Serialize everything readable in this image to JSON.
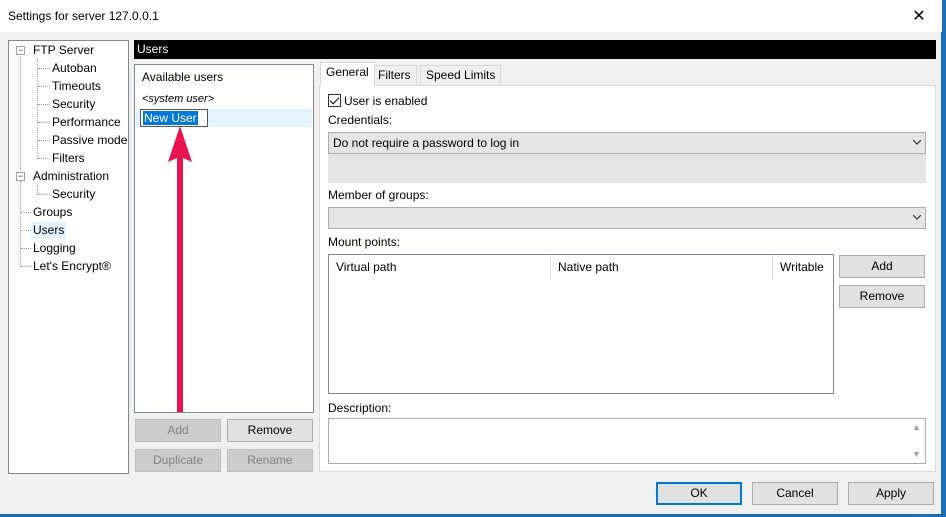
{
  "window": {
    "title": "Settings for server 127.0.0.1",
    "close_glyph": "✕"
  },
  "tree": {
    "items": [
      {
        "label": "FTP Server",
        "expander": "−"
      },
      {
        "label": "Autoban"
      },
      {
        "label": "Timeouts"
      },
      {
        "label": "Security"
      },
      {
        "label": "Performance"
      },
      {
        "label": "Passive mode"
      },
      {
        "label": "Filters"
      },
      {
        "label": "Administration",
        "expander": "−"
      },
      {
        "label": "Security"
      },
      {
        "label": "Groups"
      },
      {
        "label": "Users"
      },
      {
        "label": "Logging"
      },
      {
        "label": "Let's Encrypt®"
      }
    ]
  },
  "header": {
    "title": "Users"
  },
  "users": {
    "caption": "Available users",
    "system_user": "<system user>",
    "new_user_value": "New User",
    "buttons": {
      "add": "Add",
      "remove": "Remove",
      "duplicate": "Duplicate",
      "rename": "Rename"
    }
  },
  "tabs": [
    "General",
    "Filters",
    "Speed Limits"
  ],
  "general": {
    "user_enabled": "User is enabled",
    "credentials_label": "Credentials:",
    "credentials_value": "Do not require a password to log in",
    "groups_label": "Member of groups:",
    "groups_value": "",
    "mount_label": "Mount points:",
    "mount_columns": [
      "Virtual path",
      "Native path",
      "Writable"
    ],
    "mount_add": "Add",
    "mount_remove": "Remove",
    "description_label": "Description:"
  },
  "footer": {
    "ok": "OK",
    "cancel": "Cancel",
    "apply": "Apply"
  },
  "colors": {
    "accent": "#0078d7",
    "annotation_arrow": "#e8134f"
  },
  "icons": {
    "close": "close-icon",
    "chevron": "chevron-down-icon",
    "annotation": "red-arrow-annotation"
  }
}
